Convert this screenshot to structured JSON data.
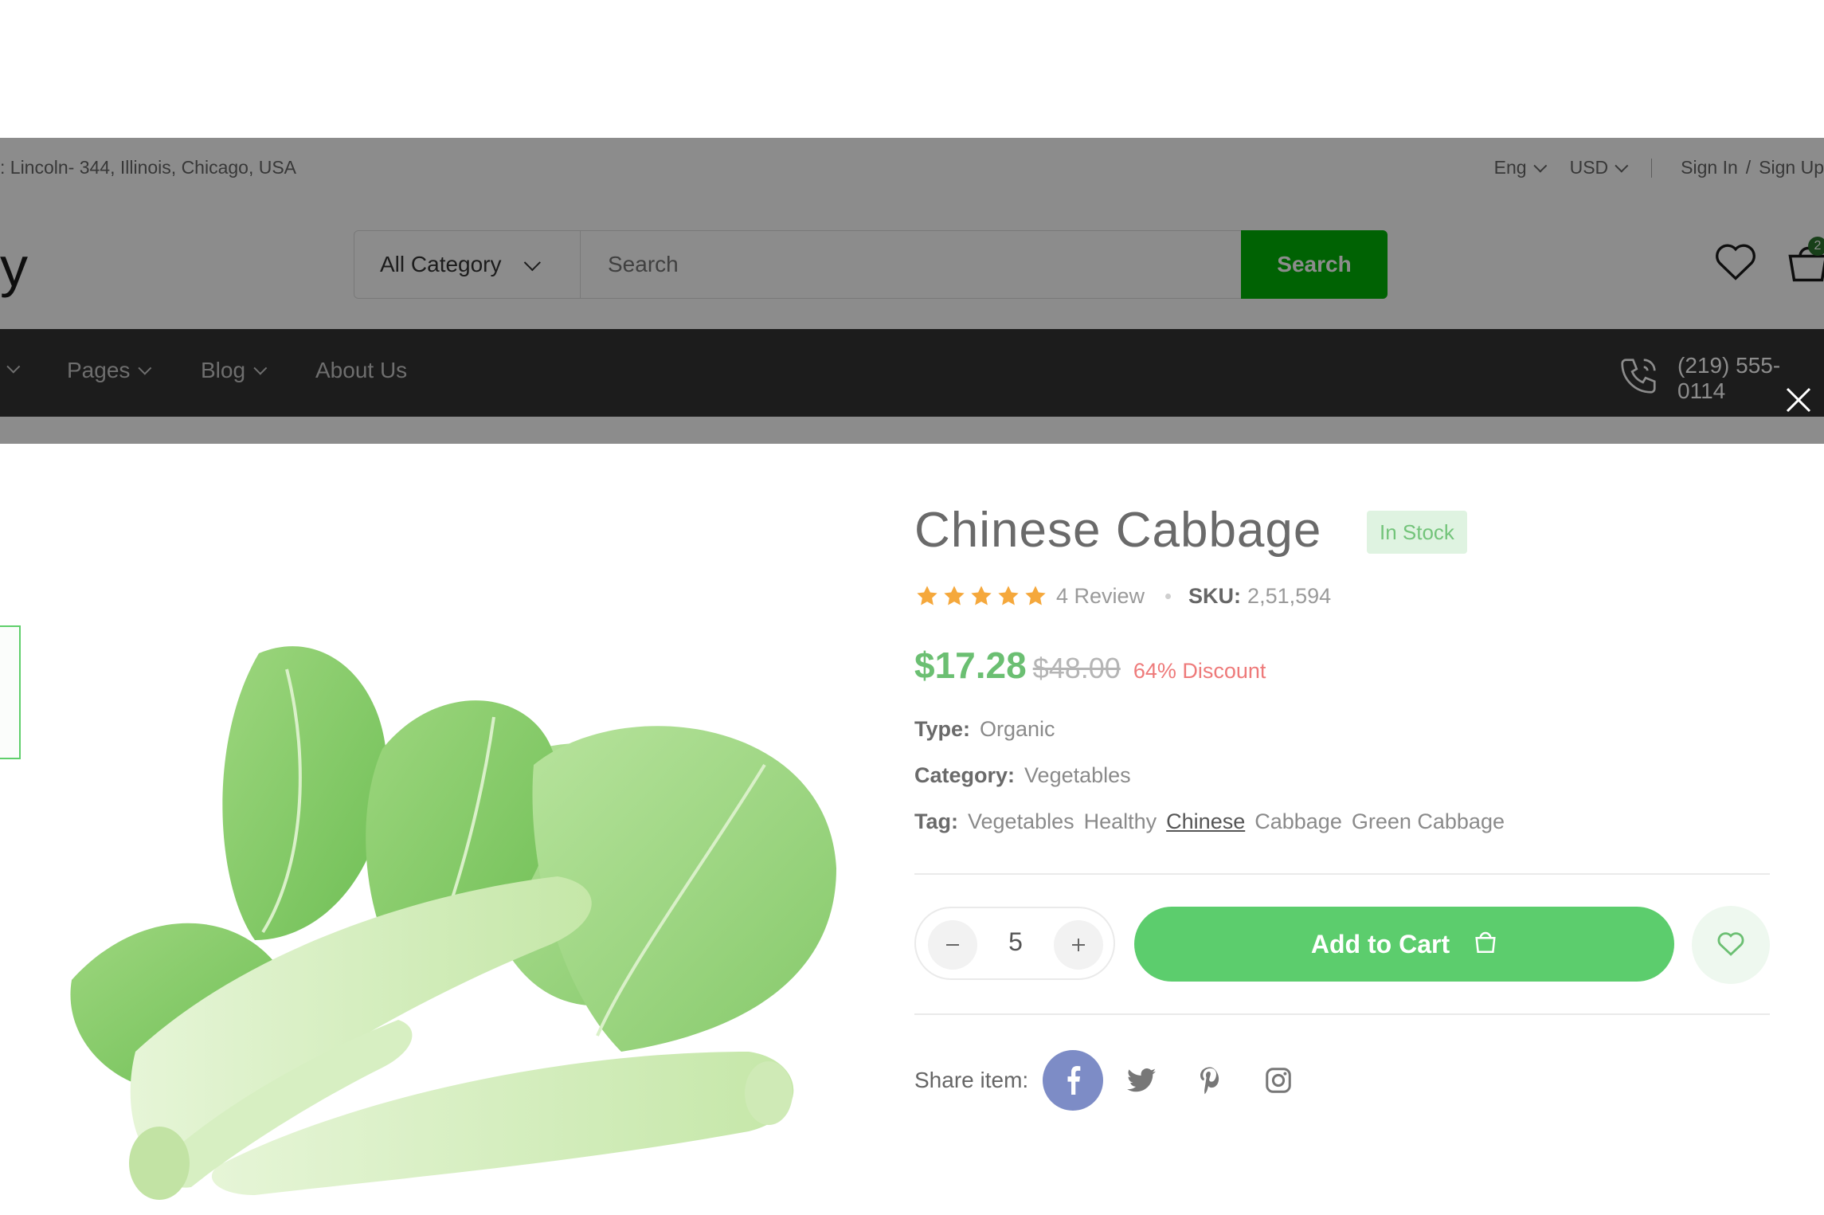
{
  "topbar": {
    "address": ": Lincoln- 344, Illinois, Chicago, USA",
    "language": "Eng",
    "currency": "USD",
    "sign_in": "Sign In",
    "separator": "/",
    "sign_up": "Sign Up"
  },
  "header": {
    "logo_fragment": "y",
    "category_label": "All Category",
    "search_placeholder": "Search",
    "search_button": "Search",
    "cart_count": "2"
  },
  "nav": {
    "items": [
      {
        "label": "Pages"
      },
      {
        "label": "Blog"
      },
      {
        "label": "About Us"
      }
    ],
    "phone": "(219) 555-0114"
  },
  "product": {
    "title": "Chinese Cabbage",
    "stock": "In Stock",
    "rating": 5,
    "reviews": "4 Review",
    "sku_label": "SKU:",
    "sku": "2,51,594",
    "price": "$17.28",
    "old_price": "$48.00",
    "discount": "64% Discount",
    "type_label": "Type:",
    "type": "Organic",
    "category_label": "Category:",
    "category": "Vegetables",
    "tag_label": "Tag:",
    "tags": [
      "Vegetables",
      "Healthy",
      "Chinese",
      "Cabbage",
      "Green Cabbage"
    ],
    "quantity": "5",
    "add_to_cart": "Add to Cart",
    "share_label": "Share item:"
  },
  "colors": {
    "brand_green": "#00b207",
    "button_green": "#5ccd6d",
    "price_green": "#6bbf72",
    "discount_red": "#ee7a7a",
    "star_orange": "#f5a83c",
    "facebook": "#7d8cc6"
  },
  "icons": [
    "chevron-down-icon",
    "heart-icon",
    "cart-icon",
    "phone-icon",
    "close-icon",
    "star-icon",
    "minus-icon",
    "plus-icon",
    "bag-icon",
    "facebook-icon",
    "twitter-icon",
    "pinterest-icon",
    "instagram-icon"
  ]
}
